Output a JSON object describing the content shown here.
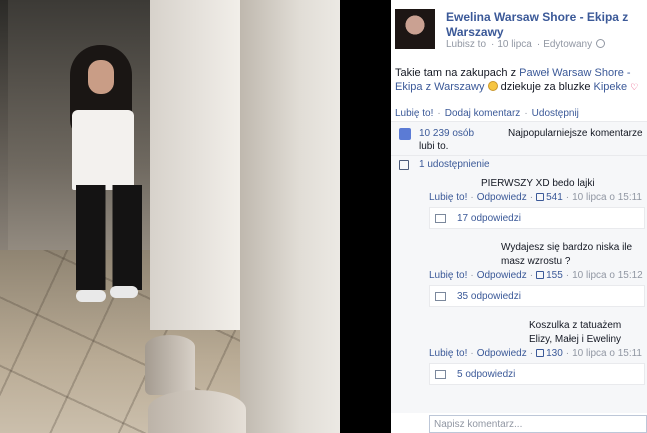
{
  "post": {
    "author": "Ewelina Warsaw Shore - Ekipa z Warszawy",
    "location": "Lubisz to",
    "date": "10 lipca",
    "edited": "Edytowany",
    "text_before": "Takie tam na zakupach z ",
    "tag_name": "Paweł Warsaw Shore - Ekipa z Warszawy",
    "text_after": " dziekuje za bluzke ",
    "tag_name2": "Kipeke"
  },
  "actions": {
    "like": "Lubię to!",
    "comment": "Dodaj komentarz",
    "share": "Udostępnij"
  },
  "likes": {
    "count": "10 239 osób",
    "suffix": "lubi to.",
    "sort": "Najpopularniejsze komentarze"
  },
  "shares": {
    "label": "1 udostępnienie"
  },
  "comments": [
    {
      "text": "PIERWSZY XD bedo lajki",
      "like": "Lubię to!",
      "reply": "Odpowiedz",
      "likes": "541",
      "date": "10 lipca o 15:11",
      "replies": "17 odpowiedzi"
    },
    {
      "text": "Wydajesz się bardzo niska ile masz wzrostu ?",
      "like": "Lubię to!",
      "reply": "Odpowiedz",
      "likes": "155",
      "date": "10 lipca o 15:12",
      "replies": "35 odpowiedzi"
    },
    {
      "text": "Koszulka z tatuażem Elizy, Małej i Eweliny",
      "like": "Lubię to!",
      "reply": "Odpowiedz",
      "likes": "130",
      "date": "10 lipca o 15:11",
      "replies": "5 odpowiedzi"
    }
  ],
  "input": {
    "placeholder": "Napisz komentarz..."
  },
  "colors": {
    "link": "#3b5998",
    "meta": "#9197a3",
    "panel_bg": "#f6f7f9"
  }
}
